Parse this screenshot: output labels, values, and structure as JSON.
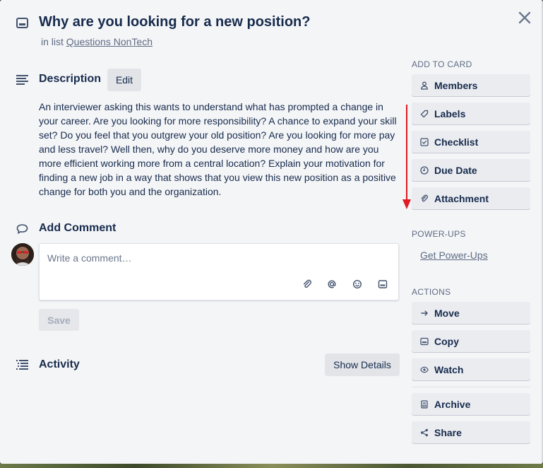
{
  "card": {
    "title": "Why are you looking for a new position?",
    "in_list_prefix": "in list",
    "list_name": "Questions NonTech"
  },
  "description": {
    "heading": "Description",
    "edit_label": "Edit",
    "text": "An interviewer asking this wants to understand what has prompted a change in your career. Are you looking for more responsibility? A chance to expand your skill set? Do you feel that you outgrew your old position? Are you looking for more pay and less travel? Well then, why do you deserve more money and how are you more efficient working more from a central location? Explain your motivation for finding a new job in a way that shows that you view this new position as a positive change for both you and the organization."
  },
  "comment": {
    "heading": "Add Comment",
    "placeholder": "Write a comment…",
    "save_label": "Save"
  },
  "activity": {
    "heading": "Activity",
    "show_details_label": "Show Details"
  },
  "sidebar": {
    "add_to_card": {
      "heading": "ADD TO CARD",
      "items": [
        {
          "label": "Members",
          "icon": "person-icon"
        },
        {
          "label": "Labels",
          "icon": "tag-icon"
        },
        {
          "label": "Checklist",
          "icon": "checkbox-icon"
        },
        {
          "label": "Due Date",
          "icon": "clock-icon"
        },
        {
          "label": "Attachment",
          "icon": "paperclip-icon"
        }
      ]
    },
    "power_ups": {
      "heading": "POWER-UPS",
      "link": "Get Power-Ups"
    },
    "actions": {
      "heading": "ACTIONS",
      "items": [
        {
          "label": "Move",
          "icon": "arrow-right-icon"
        },
        {
          "label": "Copy",
          "icon": "card-icon"
        },
        {
          "label": "Watch",
          "icon": "eye-icon"
        },
        {
          "label": "Archive",
          "icon": "archive-icon"
        },
        {
          "label": "Share",
          "icon": "share-icon"
        }
      ]
    }
  },
  "colors": {
    "accent_arrow": "#e01b24",
    "panel_bg": "#f4f5f7",
    "button_bg": "#eaecf0"
  }
}
